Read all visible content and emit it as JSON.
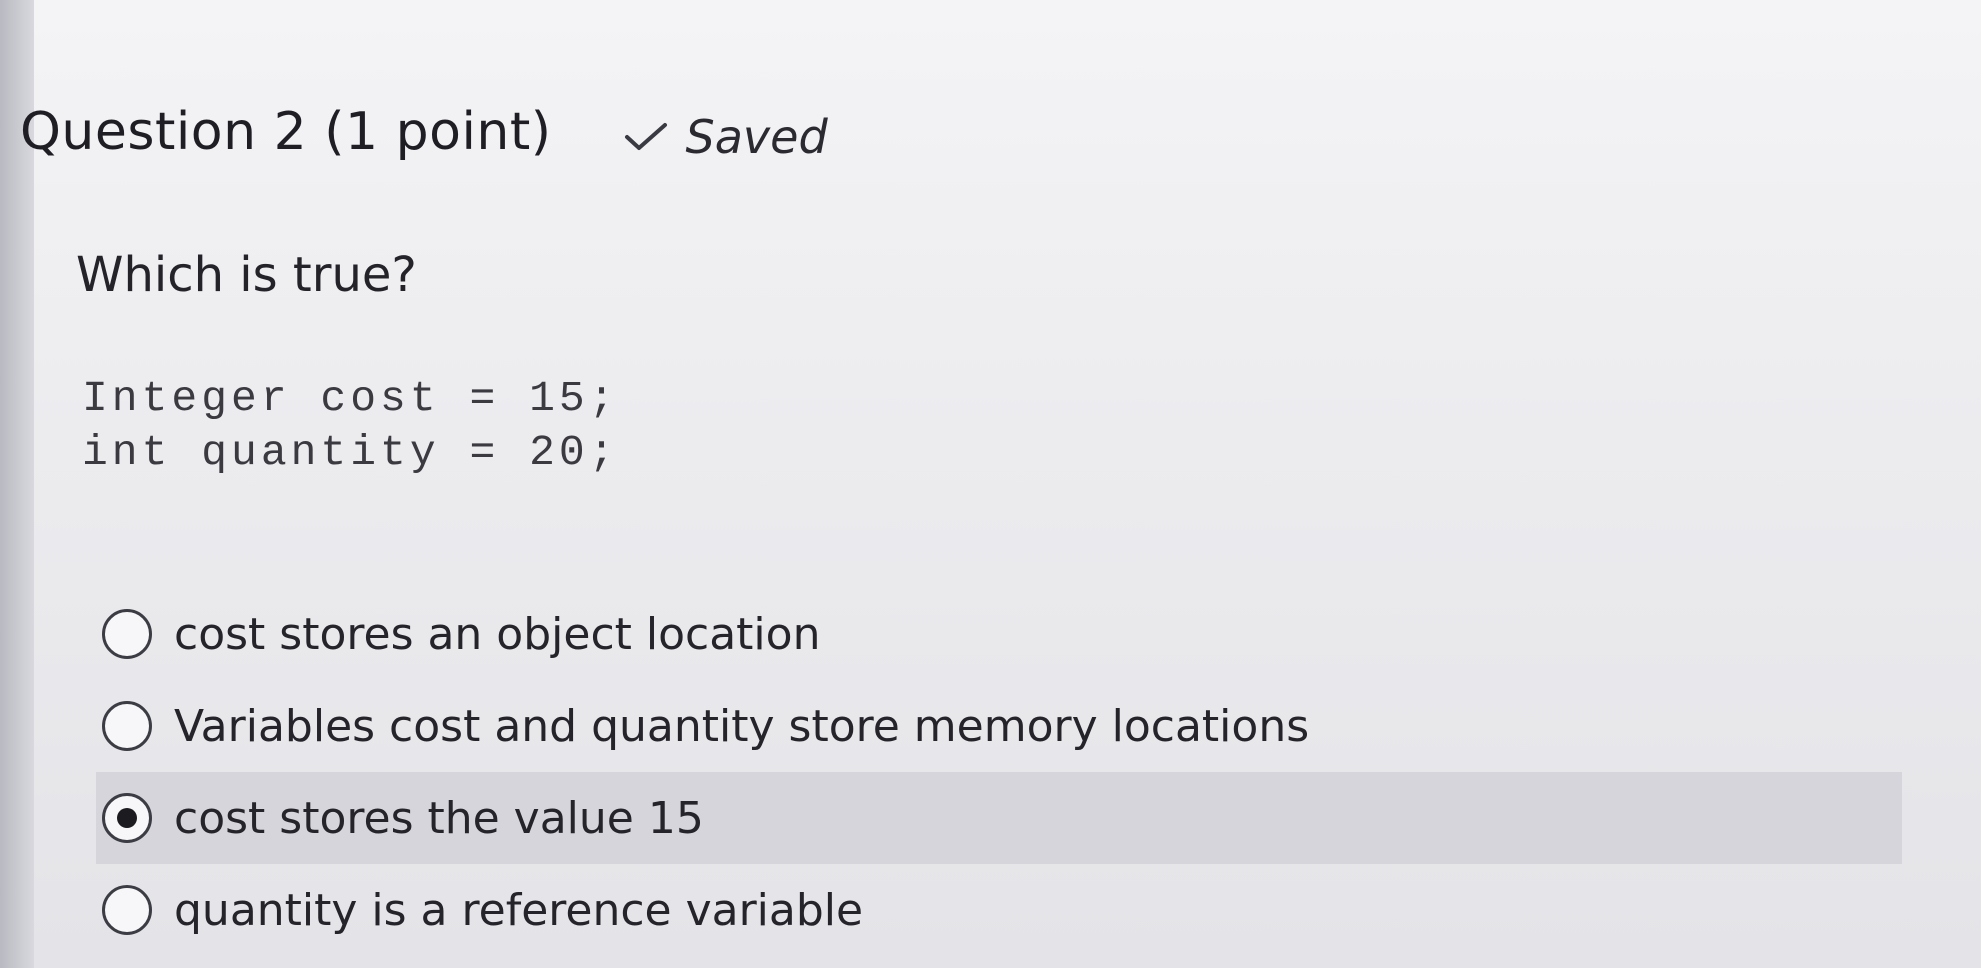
{
  "question": {
    "title": "Question 2 (1 point)",
    "status": "Saved",
    "status_icon": "checkmark-icon",
    "prompt": "Which is true?",
    "code_lines": [
      "Integer cost = 15;",
      "int quantity = 20;"
    ]
  },
  "options": [
    {
      "label": "cost stores an object location",
      "selected": false
    },
    {
      "label": "Variables cost and quantity store memory locations",
      "selected": false
    },
    {
      "label": "cost stores the value 15",
      "selected": true
    },
    {
      "label": "quantity is a reference variable",
      "selected": false
    }
  ],
  "colors": {
    "background": "#ececef",
    "selected_row": "#d5d5db",
    "text": "#1f1f24"
  }
}
